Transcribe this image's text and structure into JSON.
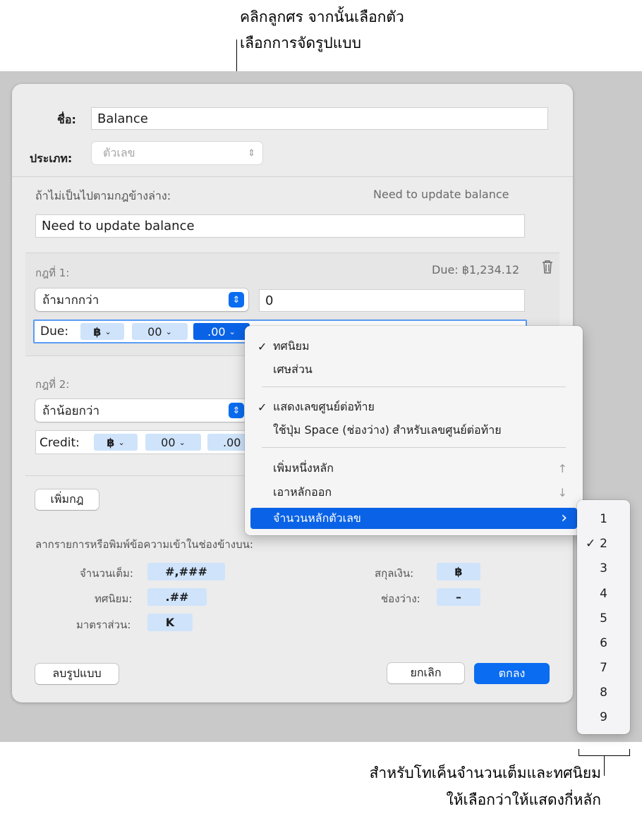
{
  "callout_top": {
    "line1": "คลิกลูกศร จากนั้นเลือกตัว",
    "line2": "เลือกการจัดรูปแบบ"
  },
  "callout_bottom": {
    "line1": "สำหรับโทเค็นจำนวนเต็มและทศนิยม",
    "line2": "ให้เลือกว่าให้แสดงกี่หลัก"
  },
  "dialog": {
    "name_label": "ชื่อ:",
    "name_value": "Balance",
    "type_label": "ประเภท:",
    "type_value": "ตัวเลข",
    "fallback_label": "ถ้าไม่เป็นไปตามกฎข้างล่าง:",
    "fallback_preview": "Need to update balance",
    "fallback_value": "Need to update balance",
    "rule1": {
      "label": "กฎที่ 1:",
      "preview": "Due: ฿1,234.12",
      "condition": "ถ้ามากกว่า",
      "value": "0",
      "format_prefix": "Due:",
      "tokens": [
        "฿",
        "00",
        ".00"
      ]
    },
    "rule2": {
      "label": "กฎที่ 2:",
      "condition": "ถ้าน้อยกว่า",
      "format_prefix": "Credit:",
      "tokens": [
        "฿",
        "00",
        ".00"
      ]
    },
    "add_rule_button": "เพิ่มกฎ",
    "drag_hint": "ลากรายการหรือพิมพ์ข้อความเข้าในช่องข้างบน:",
    "integer_label": "จำนวนเต็ม:",
    "integer_token": "#,###",
    "decimal_label": "ทศนิยม:",
    "decimal_token": ".##",
    "scale_label": "มาตราส่วน:",
    "scale_token": "K",
    "currency_label": "สกุลเงิน:",
    "currency_token": "฿",
    "space_label": "ช่องว่าง:",
    "space_token": "–",
    "delete_format_button": "ลบรูปแบบ",
    "cancel_button": "ยกเลิก",
    "ok_button": "ตกลง"
  },
  "menu": {
    "decimal": "ทศนิยม",
    "fraction": "เศษส่วน",
    "show_trailing_zeros": "แสดงเลขศูนย์ต่อท้าย",
    "use_space_trailing": "ใช้ปุ่ม Space (ช่องว่าง) สำหรับเลขศูนย์ต่อท้าย",
    "add_digit": "เพิ่มหนึ่งหลัก",
    "add_digit_key": "↑",
    "remove_digit": "เอาหลักออก",
    "remove_digit_key": "↓",
    "num_digits": "จำนวนหลักตัวเลข",
    "check": "✓",
    "chevron": "›"
  },
  "submenu": {
    "items": [
      "1",
      "2",
      "3",
      "4",
      "5",
      "6",
      "7",
      "8",
      "9"
    ],
    "selected": "2"
  },
  "colors": {
    "accent": "#0a6cf0",
    "token_bg": "#cfe3fb"
  }
}
